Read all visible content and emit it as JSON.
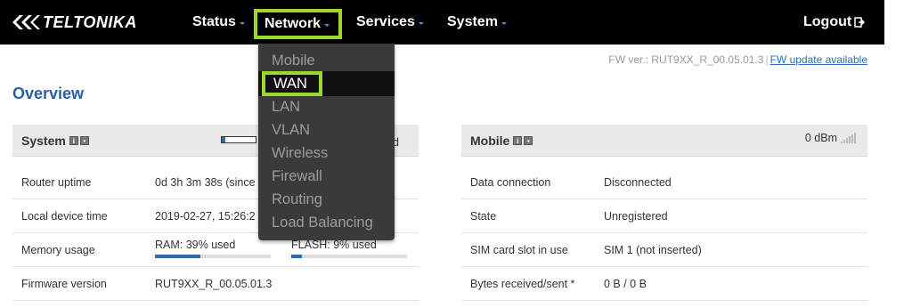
{
  "brand": {
    "logo_text": "TELTONIKA"
  },
  "nav": {
    "status": "Status",
    "network": "Network",
    "services": "Services",
    "system": "System",
    "logout": "Logout"
  },
  "network_menu": {
    "items": [
      "Mobile",
      "WAN",
      "LAN",
      "VLAN",
      "Wireless",
      "Firewall",
      "Routing",
      "Load Balancing"
    ],
    "highlighted": "WAN"
  },
  "header": {
    "fw_version": "FW ver.: RUT9XX_R_00.05.01.3",
    "separator": "|",
    "fw_update_link": "FW update available"
  },
  "page_title": "Overview",
  "system_panel": {
    "title": "System",
    "head_right_fragment": "d",
    "rows": [
      {
        "label": "Router uptime",
        "value": "0d 3h 3m 38s (since"
      },
      {
        "label": "Local device time",
        "value": "2019-02-27, 15:26:2"
      },
      {
        "label": "Memory usage",
        "ram": "RAM: 39% used",
        "flash": "FLASH: 9% used",
        "ram_fraction": 0.39,
        "flash_fraction": 0.09
      },
      {
        "label": "Firmware version",
        "value": "RUT9XX_R_00.05.01.3"
      }
    ]
  },
  "mobile_panel": {
    "title": "Mobile",
    "signal": "0 dBm",
    "rows": [
      {
        "label": "Data connection",
        "value": "Disconnected"
      },
      {
        "label": "State",
        "value": "Unregistered"
      },
      {
        "label": "SIM card slot in use",
        "value": "SIM 1 (not inserted)"
      },
      {
        "label": "Bytes received/sent *",
        "value": "0 B / 0 B"
      }
    ]
  },
  "colors": {
    "highlight": "#9fd62a",
    "link": "#2a6ebb",
    "title": "#2a5fa8",
    "topbar": "#000000",
    "dropdown": "#3a3a3a"
  }
}
